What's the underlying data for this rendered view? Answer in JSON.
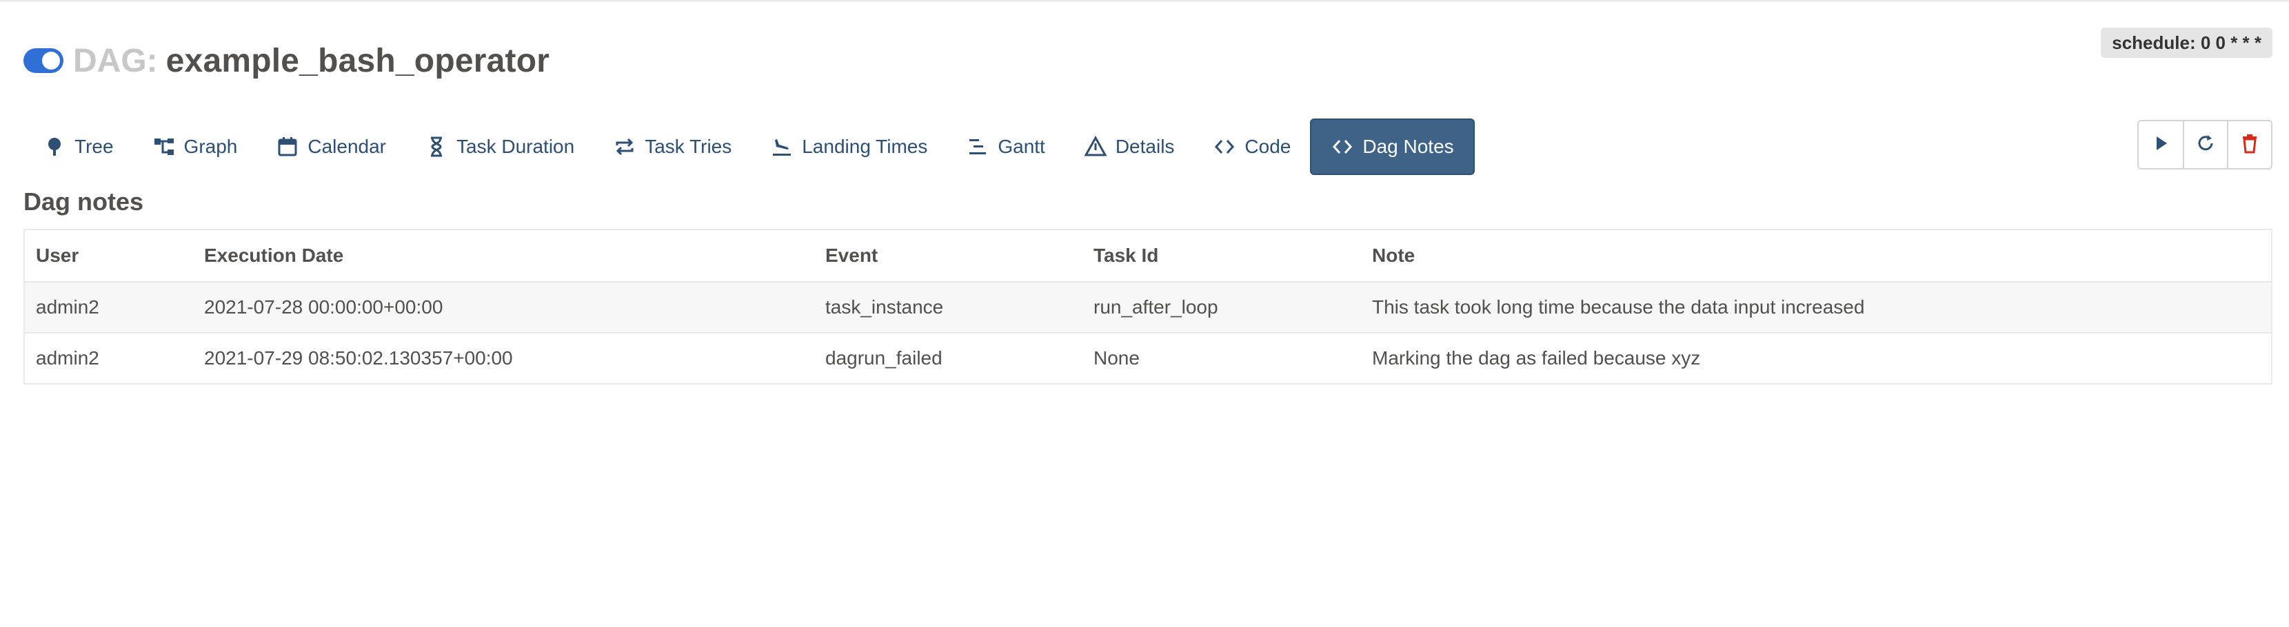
{
  "header": {
    "dag_prefix": "DAG:",
    "dag_id": "example_bash_operator",
    "schedule": "schedule: 0 0 * * *",
    "toggle_icon": "toggle-on-icon"
  },
  "tabs": [
    {
      "label": "Tree",
      "icon": "tree-icon",
      "active": false
    },
    {
      "label": "Graph",
      "icon": "graph-icon",
      "active": false
    },
    {
      "label": "Calendar",
      "icon": "calendar-icon",
      "active": false
    },
    {
      "label": "Task Duration",
      "icon": "hourglass-icon",
      "active": false
    },
    {
      "label": "Task Tries",
      "icon": "retry-icon",
      "active": false
    },
    {
      "label": "Landing Times",
      "icon": "plane-landing-icon",
      "active": false
    },
    {
      "label": "Gantt",
      "icon": "gantt-icon",
      "active": false
    },
    {
      "label": "Details",
      "icon": "warning-triangle-icon",
      "active": false
    },
    {
      "label": "Code",
      "icon": "code-icon",
      "active": false
    },
    {
      "label": "Dag Notes",
      "icon": "code-icon",
      "active": true
    }
  ],
  "actions": [
    {
      "name": "trigger-dag-button",
      "icon": "play-icon"
    },
    {
      "name": "refresh-button",
      "icon": "refresh-icon"
    },
    {
      "name": "delete-dag-button",
      "icon": "trash-icon"
    }
  ],
  "section": {
    "title": "Dag notes"
  },
  "table": {
    "columns": [
      "User",
      "Execution Date",
      "Event",
      "Task Id",
      "Note"
    ],
    "rows": [
      [
        "admin2",
        "2021-07-28 00:00:00+00:00",
        "task_instance",
        "run_after_loop",
        "This task took long time because the data input increased"
      ],
      [
        "admin2",
        "2021-07-29 08:50:02.130357+00:00",
        "dagrun_failed",
        "None",
        "Marking the dag as failed because xyz"
      ]
    ]
  },
  "colors": {
    "tab_text": "#2d4f73",
    "active_tab_bg": "#3f6387",
    "toggle_on": "#2f6fd6",
    "delete_red": "#d9291c"
  }
}
